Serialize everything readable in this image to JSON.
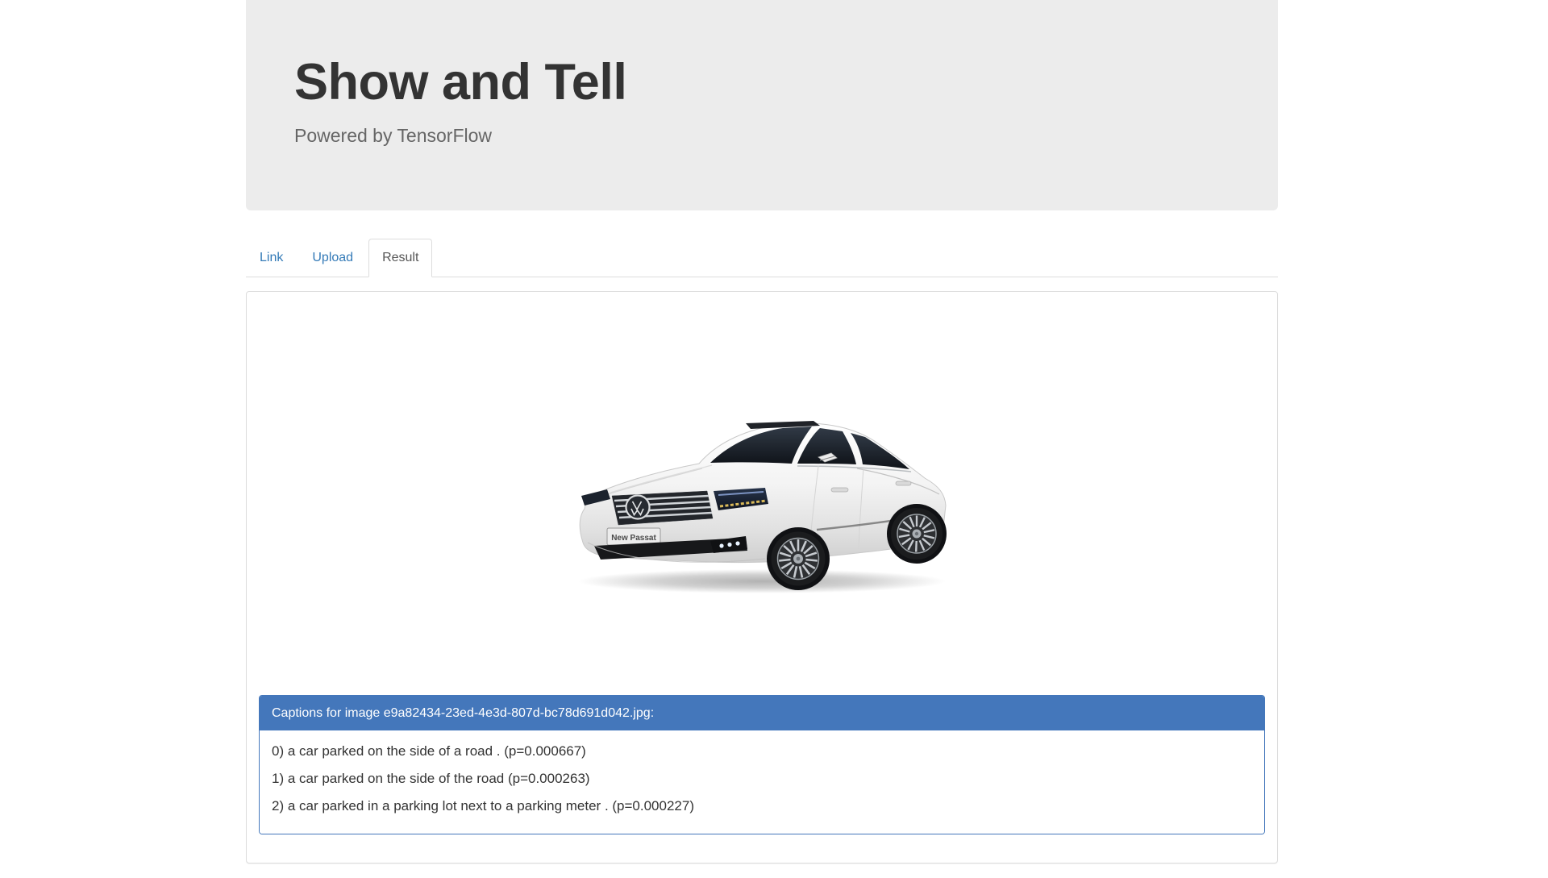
{
  "header": {
    "title": "Show and Tell",
    "subtitle": "Powered by TensorFlow"
  },
  "tabs": [
    {
      "label": "Link",
      "active": false
    },
    {
      "label": "Upload",
      "active": false
    },
    {
      "label": "Result",
      "active": true
    }
  ],
  "result": {
    "car_plate": "New Passat",
    "captions_heading": "Captions for image e9a82434-23ed-4e3d-807d-bc78d691d042.jpg:",
    "captions": [
      "0) a car parked on the side of a road . (p=0.000667)",
      "1) a car parked on the side of the road (p=0.000263)",
      "2) a car parked in a parking lot next to a parking meter . (p=0.000227)"
    ]
  },
  "colors": {
    "accent_blue": "#4477bb",
    "link_blue": "#337ab7",
    "jumbotron_bg": "#ececec",
    "active_tab_text": "#555555",
    "border_gray": "#dddddd"
  }
}
